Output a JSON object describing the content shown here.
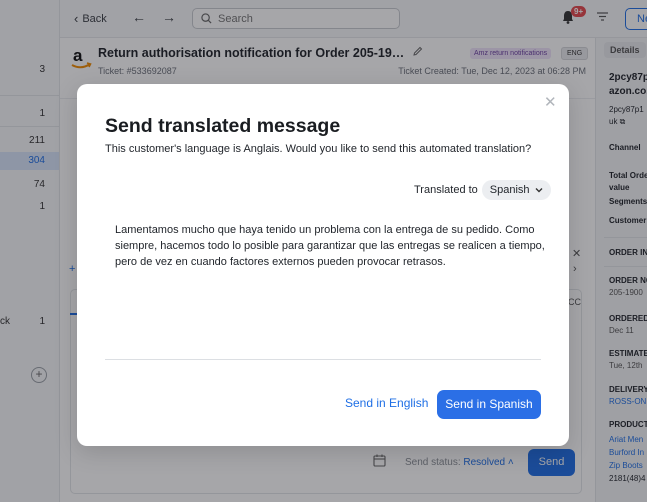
{
  "left_panel": {
    "counts": [
      "3",
      "1",
      "211",
      "304",
      "74",
      "1",
      "1"
    ],
    "partial_label": "ck",
    "add_label": "+"
  },
  "topbar": {
    "back_label": "Back",
    "search_placeholder": "Search",
    "notifications_badge": "9+",
    "new_label": "Ne"
  },
  "ticket": {
    "title": "Return authorisation notification for Order 205-19…",
    "tag_purple": "Amz return notifications",
    "tag_lang": "ENG",
    "ticket_id": "Ticket: #533692087",
    "created": "Ticket Created: Tue, Dec 12, 2023 at 06:28 PM"
  },
  "conversation": {
    "cc_label": "CC",
    "send_status_label": "Send status:",
    "send_status_value": "Resolved",
    "send_label": "Send"
  },
  "right_panel": {
    "details_tab": "Details",
    "lines": [
      {
        "text": "2pcy87p",
        "style": "big"
      },
      {
        "text": "azon.co.",
        "style": "big"
      },
      {
        "text": "2pcy87p1",
        "style": ""
      },
      {
        "text": "uk ⧉",
        "style": ""
      },
      {
        "text": "Channel",
        "style": "b"
      },
      {
        "text": "Total Orde",
        "style": "b"
      },
      {
        "text": "value",
        "style": "b"
      },
      {
        "text": "Segments",
        "style": "b"
      },
      {
        "text": "Customer",
        "style": "b"
      },
      {
        "text": "ORDER IN",
        "style": "b"
      },
      {
        "text": "ORDER NO",
        "style": "b"
      },
      {
        "text": "205-1900",
        "style": "gray"
      },
      {
        "text": "ORDERED",
        "style": "b"
      },
      {
        "text": "Dec 11",
        "style": "gray"
      },
      {
        "text": "ESTIMATE",
        "style": "b"
      },
      {
        "text": "Tue, 12th",
        "style": "gray"
      },
      {
        "text": "DELIVERY",
        "style": "b"
      },
      {
        "text": "ROSS-ON",
        "style": "link"
      },
      {
        "text": "PRODUCT",
        "style": "b"
      },
      {
        "text": "Ariat Men",
        "style": "link"
      },
      {
        "text": "Burford In",
        "style": "link"
      },
      {
        "text": "Zip Boots",
        "style": "link"
      },
      {
        "text": "2181(48)4",
        "style": ""
      }
    ]
  },
  "modal": {
    "title": "Send translated message",
    "subtitle": "This customer's language is Anglais. Would you like to send this automated translation?",
    "translated_to_label": "Translated to",
    "language": "Spanish",
    "message": "Lamentamos mucho que haya tenido un problema con la entrega de su pedido. Como siempre, hacemos todo lo posible para garantizar que las entregas se realicen a tiempo, pero de vez en cuando factores externos pueden provocar retrasos.",
    "send_english_label": "Send in English",
    "send_spanish_label": "Send in Spanish"
  },
  "colors": {
    "accent": "#1f6fe5",
    "badge": "#e5484d",
    "tag_purple_bg": "#efe4fb"
  }
}
